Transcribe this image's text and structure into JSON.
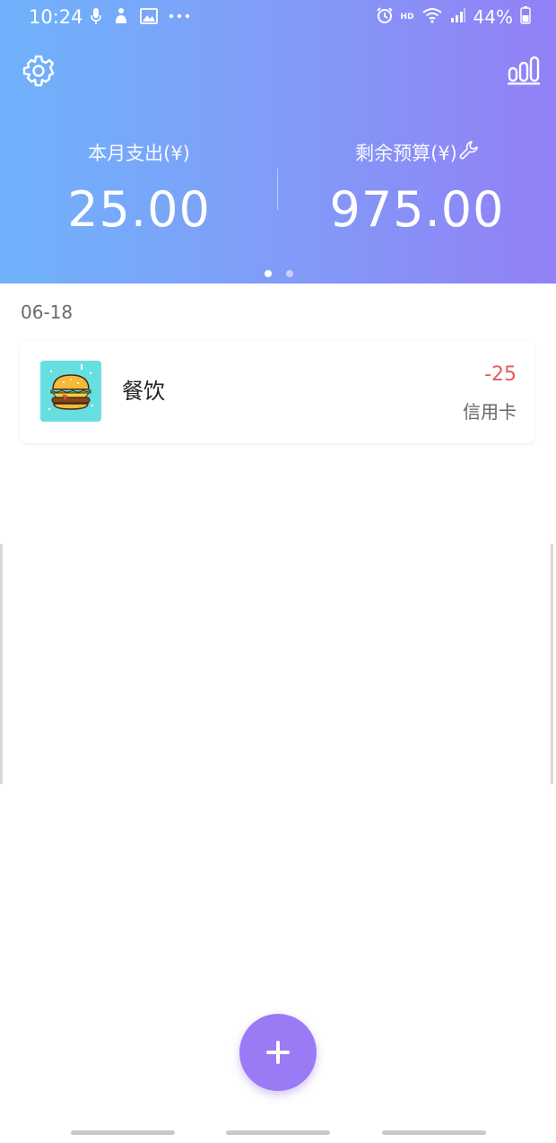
{
  "status_bar": {
    "time": "10:24",
    "battery": "44%",
    "network_badge": "HD",
    "icons": [
      "mic-icon",
      "accessibility-icon",
      "image-icon",
      "more-dots-icon",
      "alarm-icon",
      "wifi-icon",
      "signal-icon",
      "battery-icon"
    ]
  },
  "header": {
    "settings_icon": "gear-icon",
    "stats_icon": "bar-chart-icon",
    "expense_label": "本月支出(¥)",
    "expense_value": "25.00",
    "budget_label": "剩余预算(¥)",
    "budget_edit_icon": "wrench-icon",
    "budget_value": "975.00",
    "page_count": 2,
    "active_page": 1
  },
  "records": [
    {
      "date": "06-18",
      "items": [
        {
          "category": "餐饮",
          "category_icon": "burger-icon",
          "amount": "-25",
          "payment_method": "信用卡"
        }
      ]
    }
  ],
  "fab": {
    "icon": "plus-icon"
  },
  "colors": {
    "header_gradient_start": "#6fb2fb",
    "header_gradient_end": "#9280f6",
    "fab": "#9a7af5",
    "amount_negative": "#e35d5d",
    "category_bg": "#67dfe0"
  }
}
